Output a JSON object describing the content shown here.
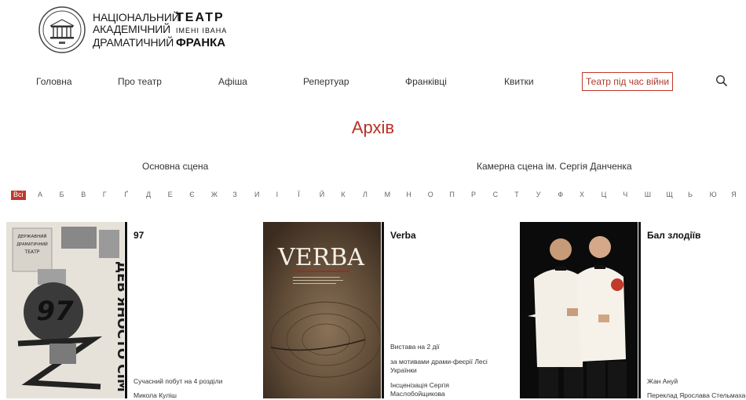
{
  "header": {
    "line1_left": "НАЦІОНАЛЬНИЙ",
    "line1_right": "ТЕАТР",
    "line2_left": "АКАДЕМІЧНИЙ",
    "line2_right": "ІМЕНІ ІВАНА",
    "line3_left": "ДРАМАТИЧНИЙ",
    "line3_right": "ФРАНКА"
  },
  "nav": {
    "items": [
      "Головна",
      "Про театр",
      "Афіша",
      "Репертуар",
      "Франківці",
      "Квитки"
    ],
    "highlight": "Театр під час війни",
    "search_icon": "search-icon"
  },
  "page": {
    "title": "Архів"
  },
  "scenes": [
    "Основна сцена",
    "Камерна сцена ім. Сергія Данченка"
  ],
  "alphabet": {
    "active": "Всі",
    "letters": [
      "А",
      "Б",
      "В",
      "Г",
      "Ґ",
      "Д",
      "Е",
      "Є",
      "Ж",
      "З",
      "И",
      "І",
      "Ї",
      "Й",
      "К",
      "Л",
      "М",
      "Н",
      "О",
      "П",
      "Р",
      "С",
      "Т",
      "У",
      "Ф",
      "Х",
      "Ц",
      "Ч",
      "Ш",
      "Щ",
      "Ь",
      "Ю",
      "Я"
    ]
  },
  "cards": [
    {
      "title": "97",
      "lines": [
        "Сучасний побут на 4 розділи",
        "Микола Куліш"
      ],
      "poster_text": [
        "ДЕРЖАВНИЙ",
        "ДРАМАТИЧНИЙ",
        "ТЕАТР",
        "ДЕВ'ЯНОСТО СІМ"
      ]
    },
    {
      "title": "Verba",
      "lines": [
        "Вистава на 2 дії",
        "за мотивами драми-феєрії Лесі Українки",
        "Інсценізація Сергія Маслобойщикова"
      ],
      "poster_text": [
        "VERBA"
      ]
    },
    {
      "title": "Бал злодіїв",
      "lines": [
        "Жан Ануй",
        "Переклад Ярослава Стельмаха"
      ]
    }
  ],
  "colors": {
    "accent": "#c0392b",
    "text": "#222222"
  }
}
